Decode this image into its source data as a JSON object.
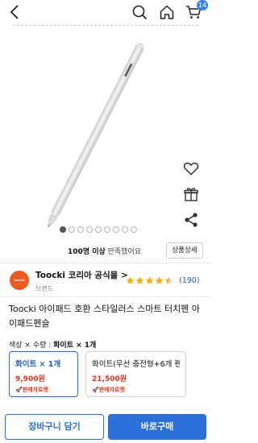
{
  "topbar": {
    "back_icon": "chevron-left-icon",
    "search_icon": "search-icon",
    "home_icon": "home-icon",
    "cart_icon": "cart-icon",
    "cart_count": "14"
  },
  "product": {
    "views_count": "100명 이상",
    "views_suffix": " 만족했어요",
    "detail_button": "상품상세",
    "carousel": {
      "total": 9,
      "active_index": 0
    },
    "side_actions": [
      "heart-icon",
      "gift-icon",
      "share-icon"
    ]
  },
  "seller": {
    "logo_text": "toocki",
    "name": "Toocki 코리아 공식몰",
    "chevron": ">",
    "tag": "브랜드",
    "rating_value": 4.5,
    "rating_max": 5,
    "review_count": "(190)"
  },
  "title": "Toocki 아이패드 호환 스타일러스 스마트 터치펜 아이패드펜슬",
  "options": {
    "label_prefix": "색상 × 수량 : ",
    "label_value": "화이트 × 1개",
    "items": [
      {
        "name": "화이트 × 1개",
        "price": "9,900원",
        "badge": "🚀판매자로켓",
        "selected": true
      },
      {
        "name": "화이트(무선 충전형+6개 펜...",
        "price": "21,500원",
        "badge": "🚀판매자로켓",
        "selected": false
      }
    ]
  },
  "actions": {
    "cart": "장바구니 담기",
    "buy": "바로구매"
  },
  "colors": {
    "accent": "#2a70d8",
    "price": "#e8321b",
    "star": "#f5b000",
    "brand_logo": "#ec5a21"
  }
}
